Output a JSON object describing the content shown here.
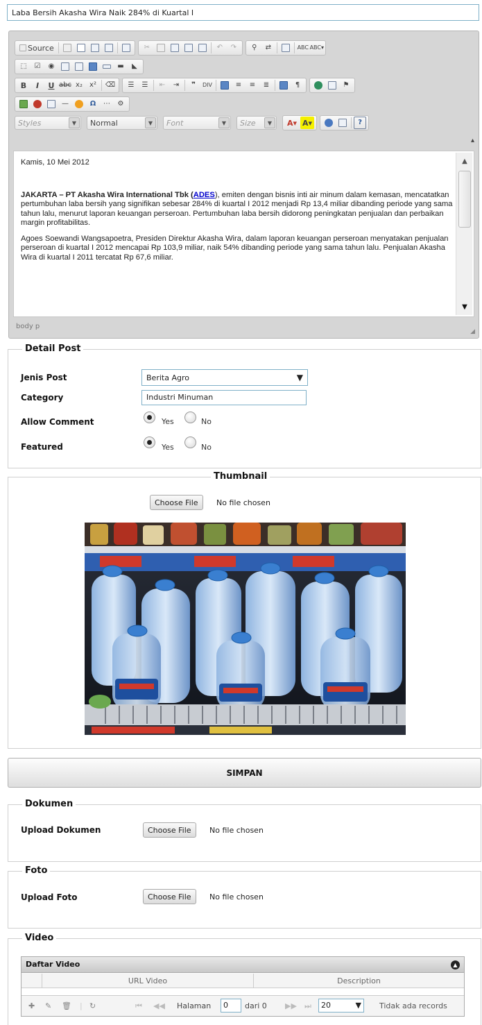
{
  "title_value": "Laba Bersih Akasha Wira Naik 284% di Kuartal I",
  "editor": {
    "source_label": "Source",
    "combos": {
      "styles": "Styles",
      "format": "Normal",
      "font": "Font",
      "size": "Size"
    },
    "content": {
      "date": "Kamis, 10 Mei 2012",
      "p1_lead": "JAKARTA – PT Akasha Wira International Tbk (",
      "p1_link": "ADES",
      "p1_rest": "), emiten dengan bisnis inti air minum dalam kemasan, mencatatkan pertumbuhan laba bersih yang signifikan sebesar 284% di kuartal I 2012 menjadi Rp 13,4 miliar dibanding periode yang sama tahun lalu, menurut laporan keuangan perseroan. Pertumbuhan laba bersih didorong peningkatan penjualan dan perbaikan margin profitabilitas.",
      "p2": "Agoes Soewandi Wangsapoetra, Presiden Direktur Akasha Wira, dalam laporan keuangan perseroan menyatakan penjualan perseroan di kuartal I 2012 mencapai Rp 103,9 miliar, naik 54% dibanding periode yang sama tahun lalu. Penjualan Akasha Wira di kuartal I 2011 tercatat Rp 67,6 miliar."
    },
    "status_path": "body  p"
  },
  "detail_post": {
    "legend": "Detail Post",
    "jenis_post_label": "Jenis Post",
    "jenis_post_value": "Berita Agro",
    "category_label": "Category",
    "category_value": "Industri Minuman",
    "allow_comment_label": "Allow Comment",
    "featured_label": "Featured",
    "yes": "Yes",
    "no": "No"
  },
  "thumbnail": {
    "legend": "Thumbnail",
    "choose_file": "Choose File",
    "no_file": "No file chosen"
  },
  "simpan_label": "SIMPAN",
  "dokumen": {
    "legend": "Dokumen",
    "label": "Upload Dokumen",
    "choose_file": "Choose File",
    "no_file": "No file chosen"
  },
  "foto": {
    "legend": "Foto",
    "label": "Upload Foto",
    "choose_file": "Choose File",
    "no_file": "No file chosen"
  },
  "video": {
    "legend": "Video",
    "grid_title": "Daftar Video",
    "col_url": "URL Video",
    "col_desc": "Description",
    "pager": {
      "halaman": "Halaman",
      "page_value": "0",
      "dari": "dari 0",
      "rows": "20",
      "records": "Tidak ada records"
    }
  },
  "colors": {
    "accent_border": "#7fb0c8",
    "bottle_cap": "#3a7fd0"
  }
}
